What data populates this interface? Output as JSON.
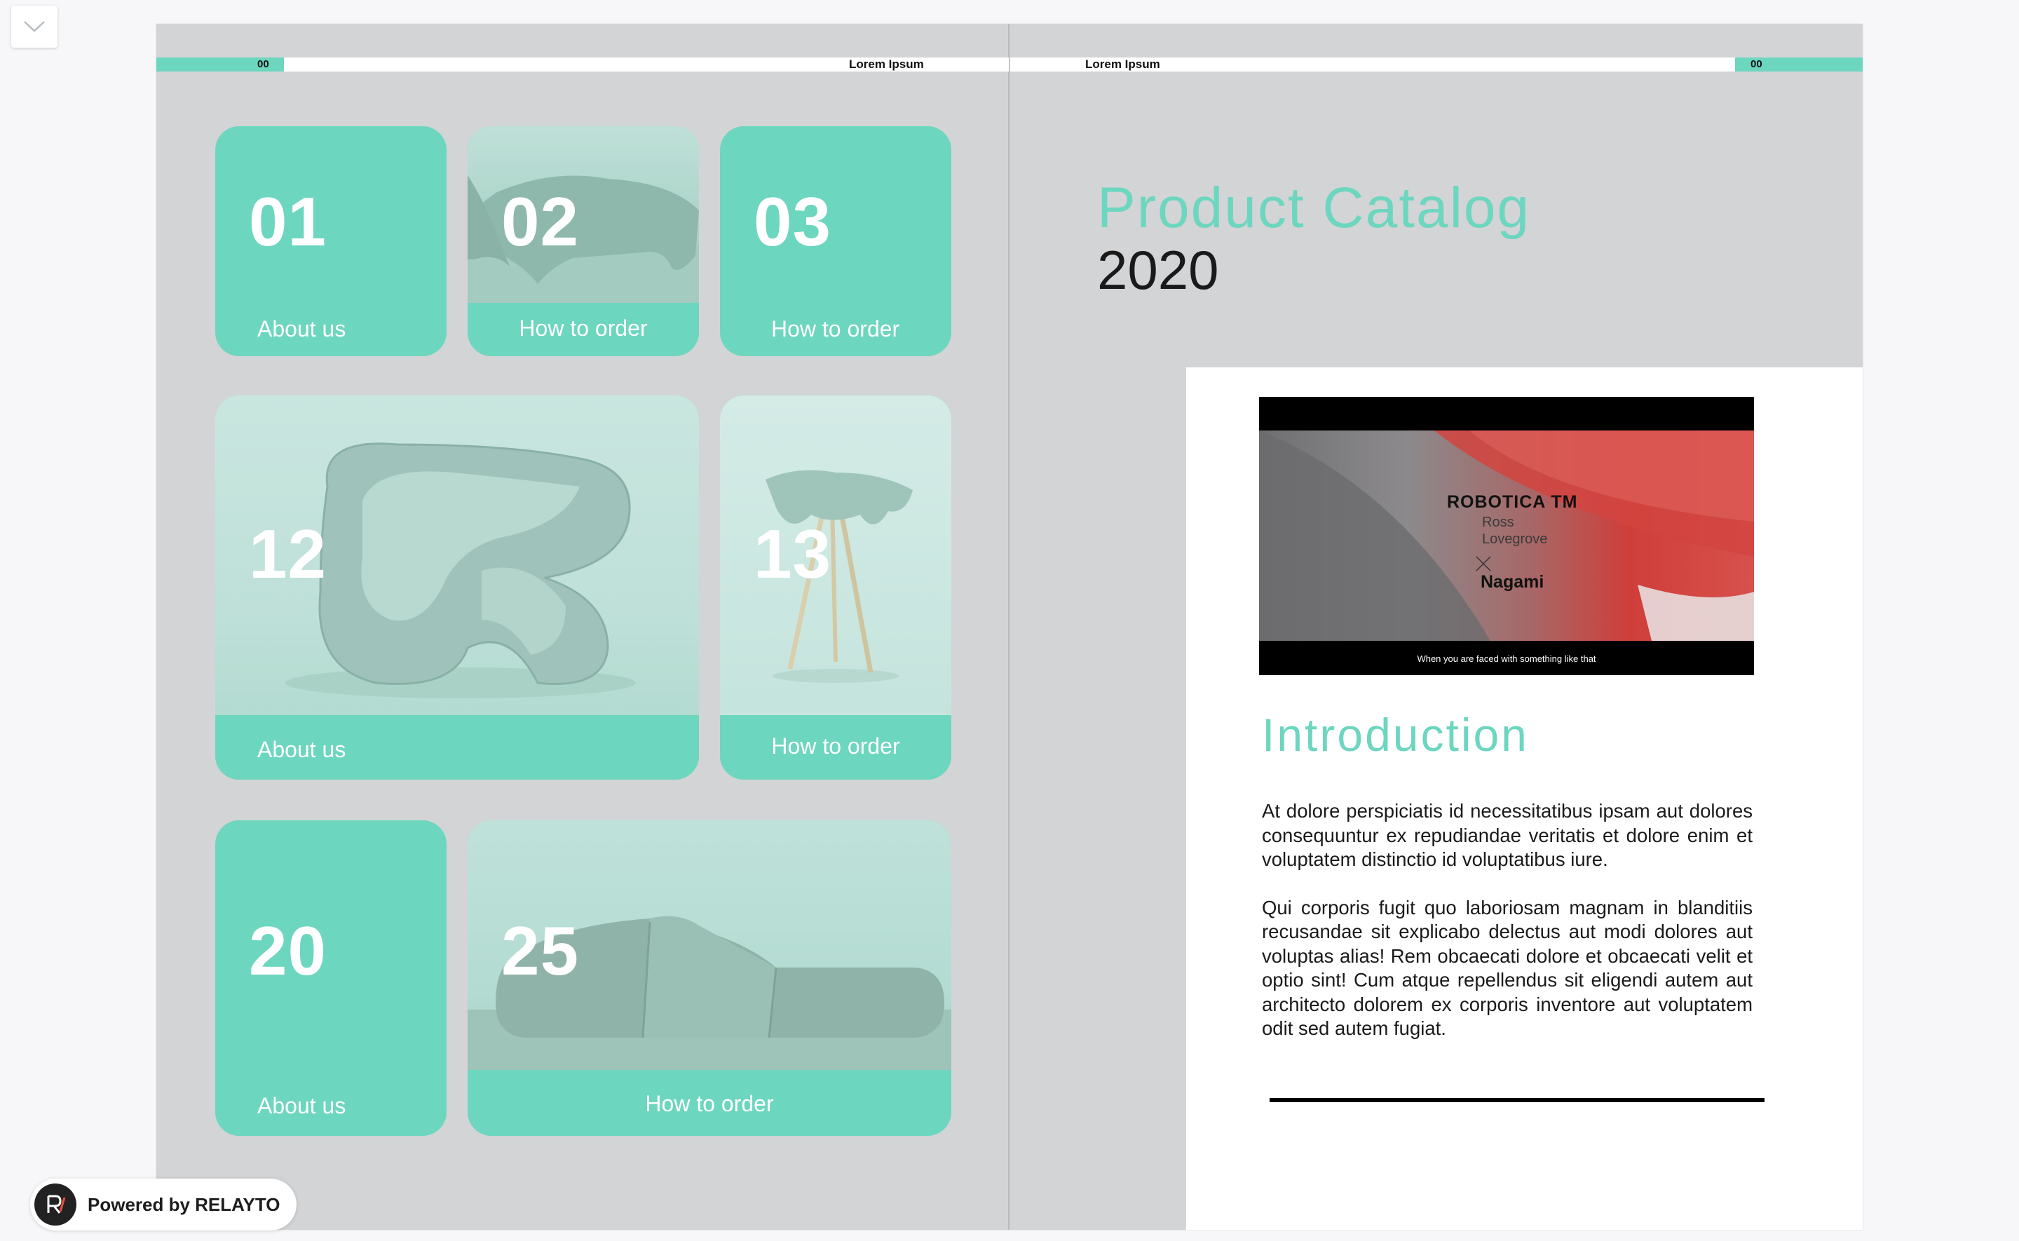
{
  "header": {
    "left_page_number": "00",
    "left_running_title": "Lorem Ipsum",
    "right_running_title": "Lorem Ipsum",
    "right_page_number": "00"
  },
  "tiles": [
    {
      "number": "01",
      "label": "About us"
    },
    {
      "number": "02",
      "label": "How to order"
    },
    {
      "number": "03",
      "label": "How to order"
    },
    {
      "number": "12",
      "label": "About us"
    },
    {
      "number": "13",
      "label": "How to order"
    },
    {
      "number": "20",
      "label": "About us"
    },
    {
      "number": "25",
      "label": "How to order"
    }
  ],
  "catalog": {
    "title": "Product Catalog",
    "year": "2020"
  },
  "video": {
    "brand": "ROBOTICA TM",
    "designer_first": "Ross",
    "designer_last": "Lovegrove",
    "cross": "X",
    "partner": "Nagami",
    "subtitle": "When you are faced with something like that"
  },
  "intro": {
    "title": "Introduction",
    "paragraph_1": "At dolore perspiciatis id necessitatibus ipsam aut dolores consequuntur ex repudiandae veritatis et dolore enim et voluptatem distinctio id voluptatibus iure.",
    "paragraph_2": "Qui corporis fugit quo laboriosam magnam in blanditiis recusandae sit explicabo delectus aut modi dolores aut voluptas alias! Rem obcaecati dolore et obcaecati velit et optio sint! Cum atque repellendus sit eligendi autem aut architecto dolorem ex corporis inventore aut voluptatem odit sed autem fugiat."
  },
  "footer": {
    "powered_label": "Powered by RELAYTO"
  },
  "colors": {
    "accent": "#6dd6bf",
    "page_background": "#d3d4d6",
    "panel": "#ffffff",
    "text": "#1a1a1a"
  },
  "icons": {
    "collapse": "chevron-down-icon",
    "brand_logo": "relayto-logo-icon"
  }
}
